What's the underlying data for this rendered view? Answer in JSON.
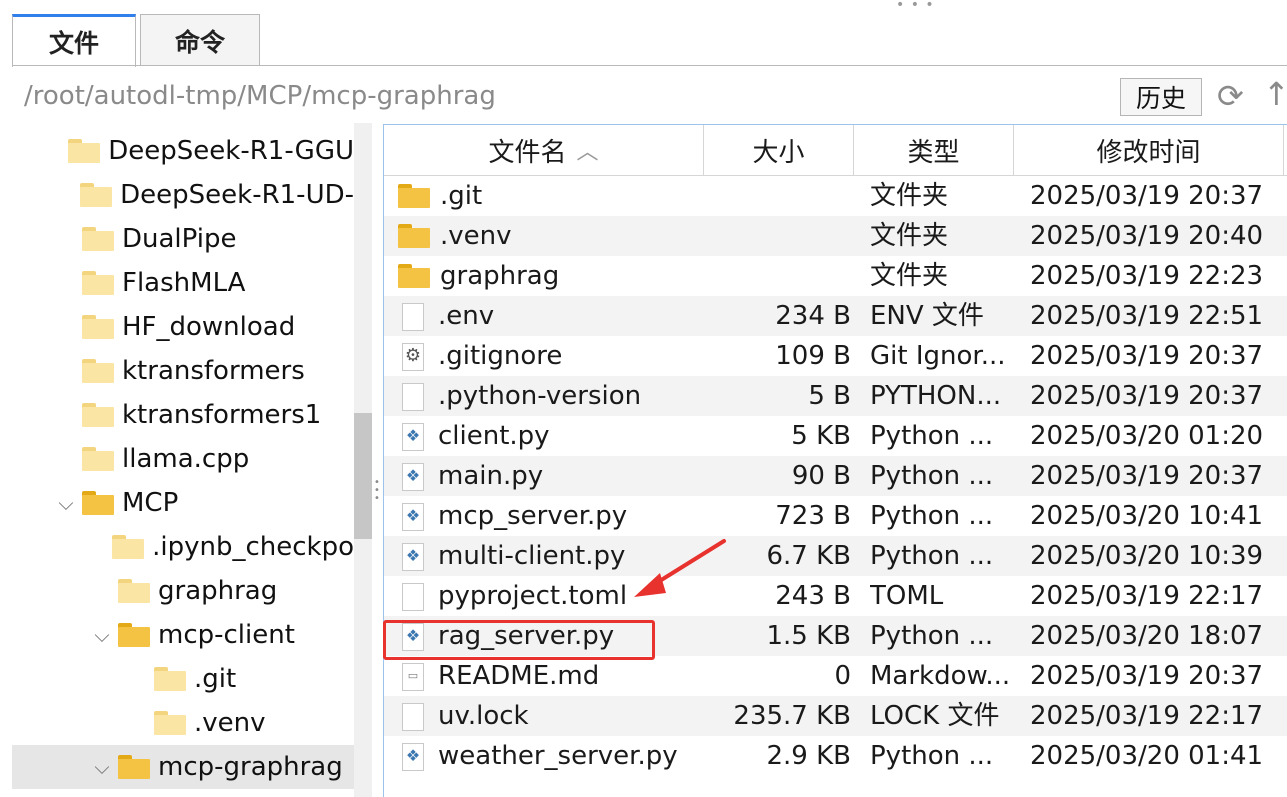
{
  "tabs": [
    {
      "label": "文件",
      "active": true
    },
    {
      "label": "命令",
      "active": false
    }
  ],
  "path": {
    "value": "/root/autodl-tmp/MCP/mcp-graphrag",
    "history_label": "历史"
  },
  "icons": {
    "refresh": "refresh-icon",
    "up": "up-arrow-icon",
    "folder": "folder-icon",
    "python": "python-file-icon"
  },
  "tree": {
    "items": [
      {
        "label": "DeepSeek-R1-GGU",
        "depth": 1,
        "expanded": null
      },
      {
        "label": "DeepSeek-R1-UD-",
        "depth": 1,
        "expanded": null
      },
      {
        "label": "DualPipe",
        "depth": 1,
        "expanded": null
      },
      {
        "label": "FlashMLA",
        "depth": 1,
        "expanded": null
      },
      {
        "label": "HF_download",
        "depth": 1,
        "expanded": null
      },
      {
        "label": "ktransformers",
        "depth": 1,
        "expanded": null
      },
      {
        "label": "ktransformers1",
        "depth": 1,
        "expanded": null
      },
      {
        "label": "llama.cpp",
        "depth": 1,
        "expanded": null
      },
      {
        "label": "MCP",
        "depth": 1,
        "expanded": true
      },
      {
        "label": ".ipynb_checkpo",
        "depth": 2,
        "expanded": null
      },
      {
        "label": "graphrag",
        "depth": 2,
        "expanded": null
      },
      {
        "label": "mcp-client",
        "depth": 2,
        "expanded": true
      },
      {
        "label": ".git",
        "depth": 3,
        "expanded": null
      },
      {
        "label": ".venv",
        "depth": 3,
        "expanded": null
      },
      {
        "label": "mcp-graphrag",
        "depth": 2,
        "expanded": true,
        "selected": true
      }
    ]
  },
  "filelist": {
    "columns": [
      {
        "label": "文件名",
        "sort": "asc"
      },
      {
        "label": "大小"
      },
      {
        "label": "类型"
      },
      {
        "label": "修改时间"
      }
    ],
    "rows": [
      {
        "name": ".git",
        "size": "",
        "type": "文件夹",
        "date": "2025/03/19 20:37",
        "icon": "folder"
      },
      {
        "name": ".venv",
        "size": "",
        "type": "文件夹",
        "date": "2025/03/19 20:40",
        "icon": "folder"
      },
      {
        "name": "graphrag",
        "size": "",
        "type": "文件夹",
        "date": "2025/03/19 22:23",
        "icon": "folder"
      },
      {
        "name": ".env",
        "size": "234 B",
        "type": "ENV 文件",
        "date": "2025/03/19 22:51",
        "icon": "file"
      },
      {
        "name": ".gitignore",
        "size": "109 B",
        "type": "Git Ignor...",
        "date": "2025/03/19 20:37",
        "icon": "gear"
      },
      {
        "name": ".python-version",
        "size": "5 B",
        "type": "PYTHON...",
        "date": "2025/03/19 20:37",
        "icon": "file"
      },
      {
        "name": "client.py",
        "size": "5 KB",
        "type": "Python ...",
        "date": "2025/03/20 01:20",
        "icon": "python"
      },
      {
        "name": "main.py",
        "size": "90 B",
        "type": "Python ...",
        "date": "2025/03/19 20:37",
        "icon": "python"
      },
      {
        "name": "mcp_server.py",
        "size": "723 B",
        "type": "Python ...",
        "date": "2025/03/20 10:41",
        "icon": "python"
      },
      {
        "name": "multi-client.py",
        "size": "6.7 KB",
        "type": "Python ...",
        "date": "2025/03/20 10:39",
        "icon": "python"
      },
      {
        "name": "pyproject.toml",
        "size": "243 B",
        "type": "TOML",
        "date": "2025/03/19 22:17",
        "icon": "file"
      },
      {
        "name": "rag_server.py",
        "size": "1.5 KB",
        "type": "Python ...",
        "date": "2025/03/20 18:07",
        "icon": "python"
      },
      {
        "name": "README.md",
        "size": "0",
        "type": "Markdow...",
        "date": "2025/03/19 20:37",
        "icon": "md"
      },
      {
        "name": "uv.lock",
        "size": "235.7 KB",
        "type": "LOCK 文件",
        "date": "2025/03/19 22:17",
        "icon": "file"
      },
      {
        "name": "weather_server.py",
        "size": "2.9 KB",
        "type": "Python ...",
        "date": "2025/03/20 01:41",
        "icon": "python"
      }
    ]
  },
  "annotation": {
    "highlight_color": "#e8322e",
    "highlighted_row": "rag_server.py"
  }
}
